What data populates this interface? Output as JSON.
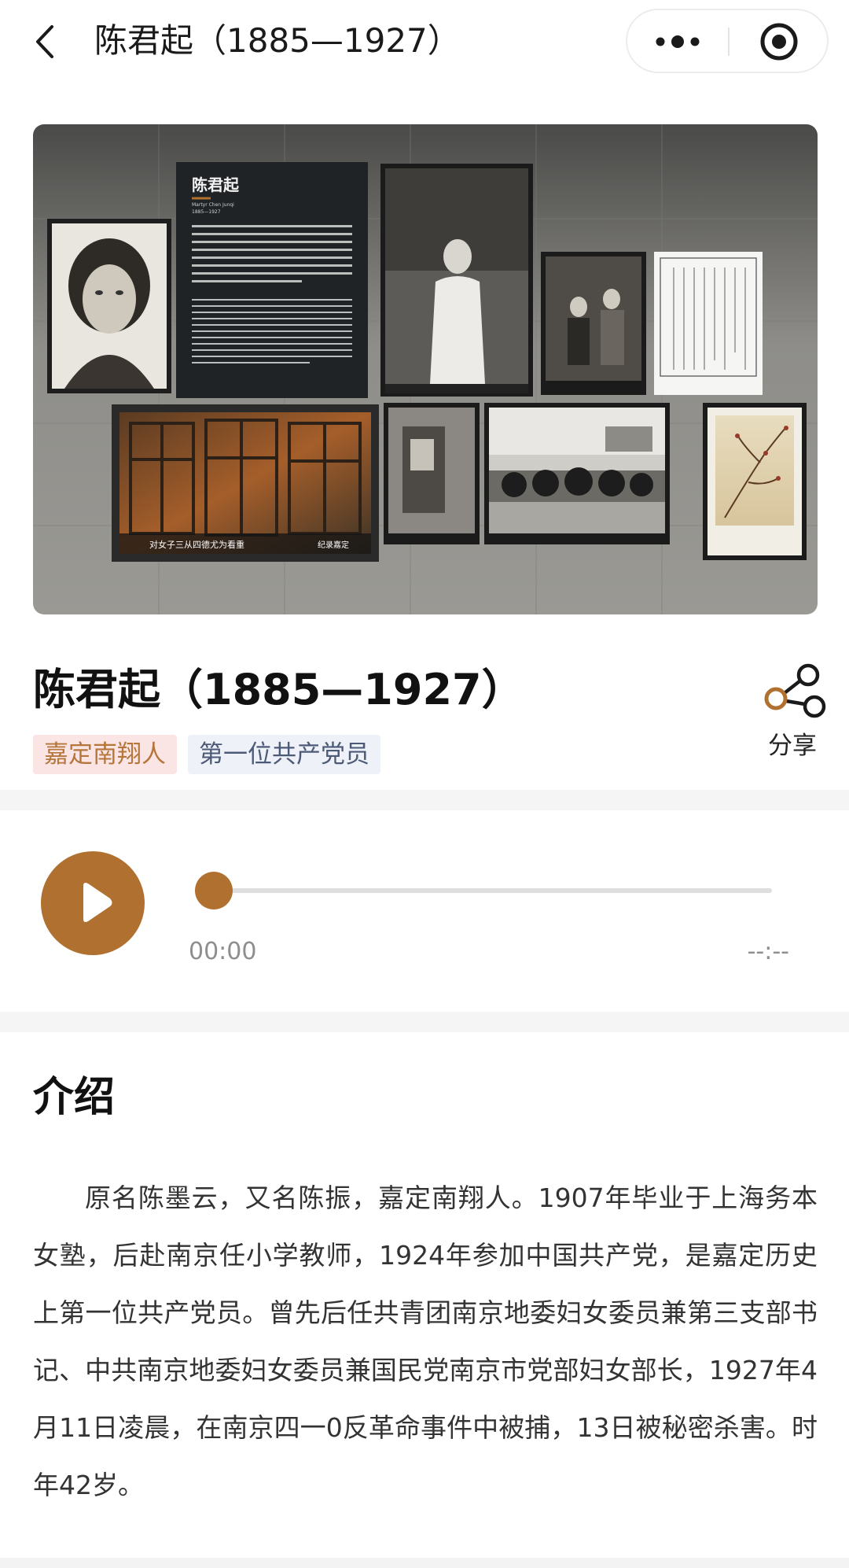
{
  "nav": {
    "title": "陈君起（1885—1927）",
    "back_icon": "chevron-left-icon",
    "more_icon": "more-dots-icon",
    "close_icon": "target-circle-icon"
  },
  "hero": {
    "board_title": "陈君起",
    "board_subtitle_en": "Martyr Chen Junqi",
    "board_years": "1885—1927",
    "video_caption": "对女子三从四德尤为看重",
    "video_tag": "纪录嘉定"
  },
  "profile": {
    "title": "陈君起（1885—1927）",
    "tags": [
      "嘉定南翔人",
      "第一位共产党员"
    ],
    "share_label": "分享",
    "share_icon": "share-icon"
  },
  "audio": {
    "play_icon": "play-icon",
    "progress": 0,
    "current_time": "00:00",
    "duration": "--:--"
  },
  "intro": {
    "heading": "介绍",
    "body": "原名陈墨云，又名陈振，嘉定南翔人。1907年毕业于上海务本女塾，后赴南京任小学教师，1924年参加中国共产党，是嘉定历史上第一位共产党员。曾先后任共青团南京地委妇女委员兼第三支部书记、中共南京地委妇女委员兼国民党南京市党部妇女部长，1927年4月11日凌晨，在南京四一0反革命事件中被捕，13日被秘密杀害。时年42岁。"
  },
  "colors": {
    "accent": "#b0702f",
    "tag1_bg": "#fbe4e4",
    "tag1_text": "#b4763b",
    "tag2_bg": "#eef1f7",
    "tag2_text": "#4c5a78"
  }
}
